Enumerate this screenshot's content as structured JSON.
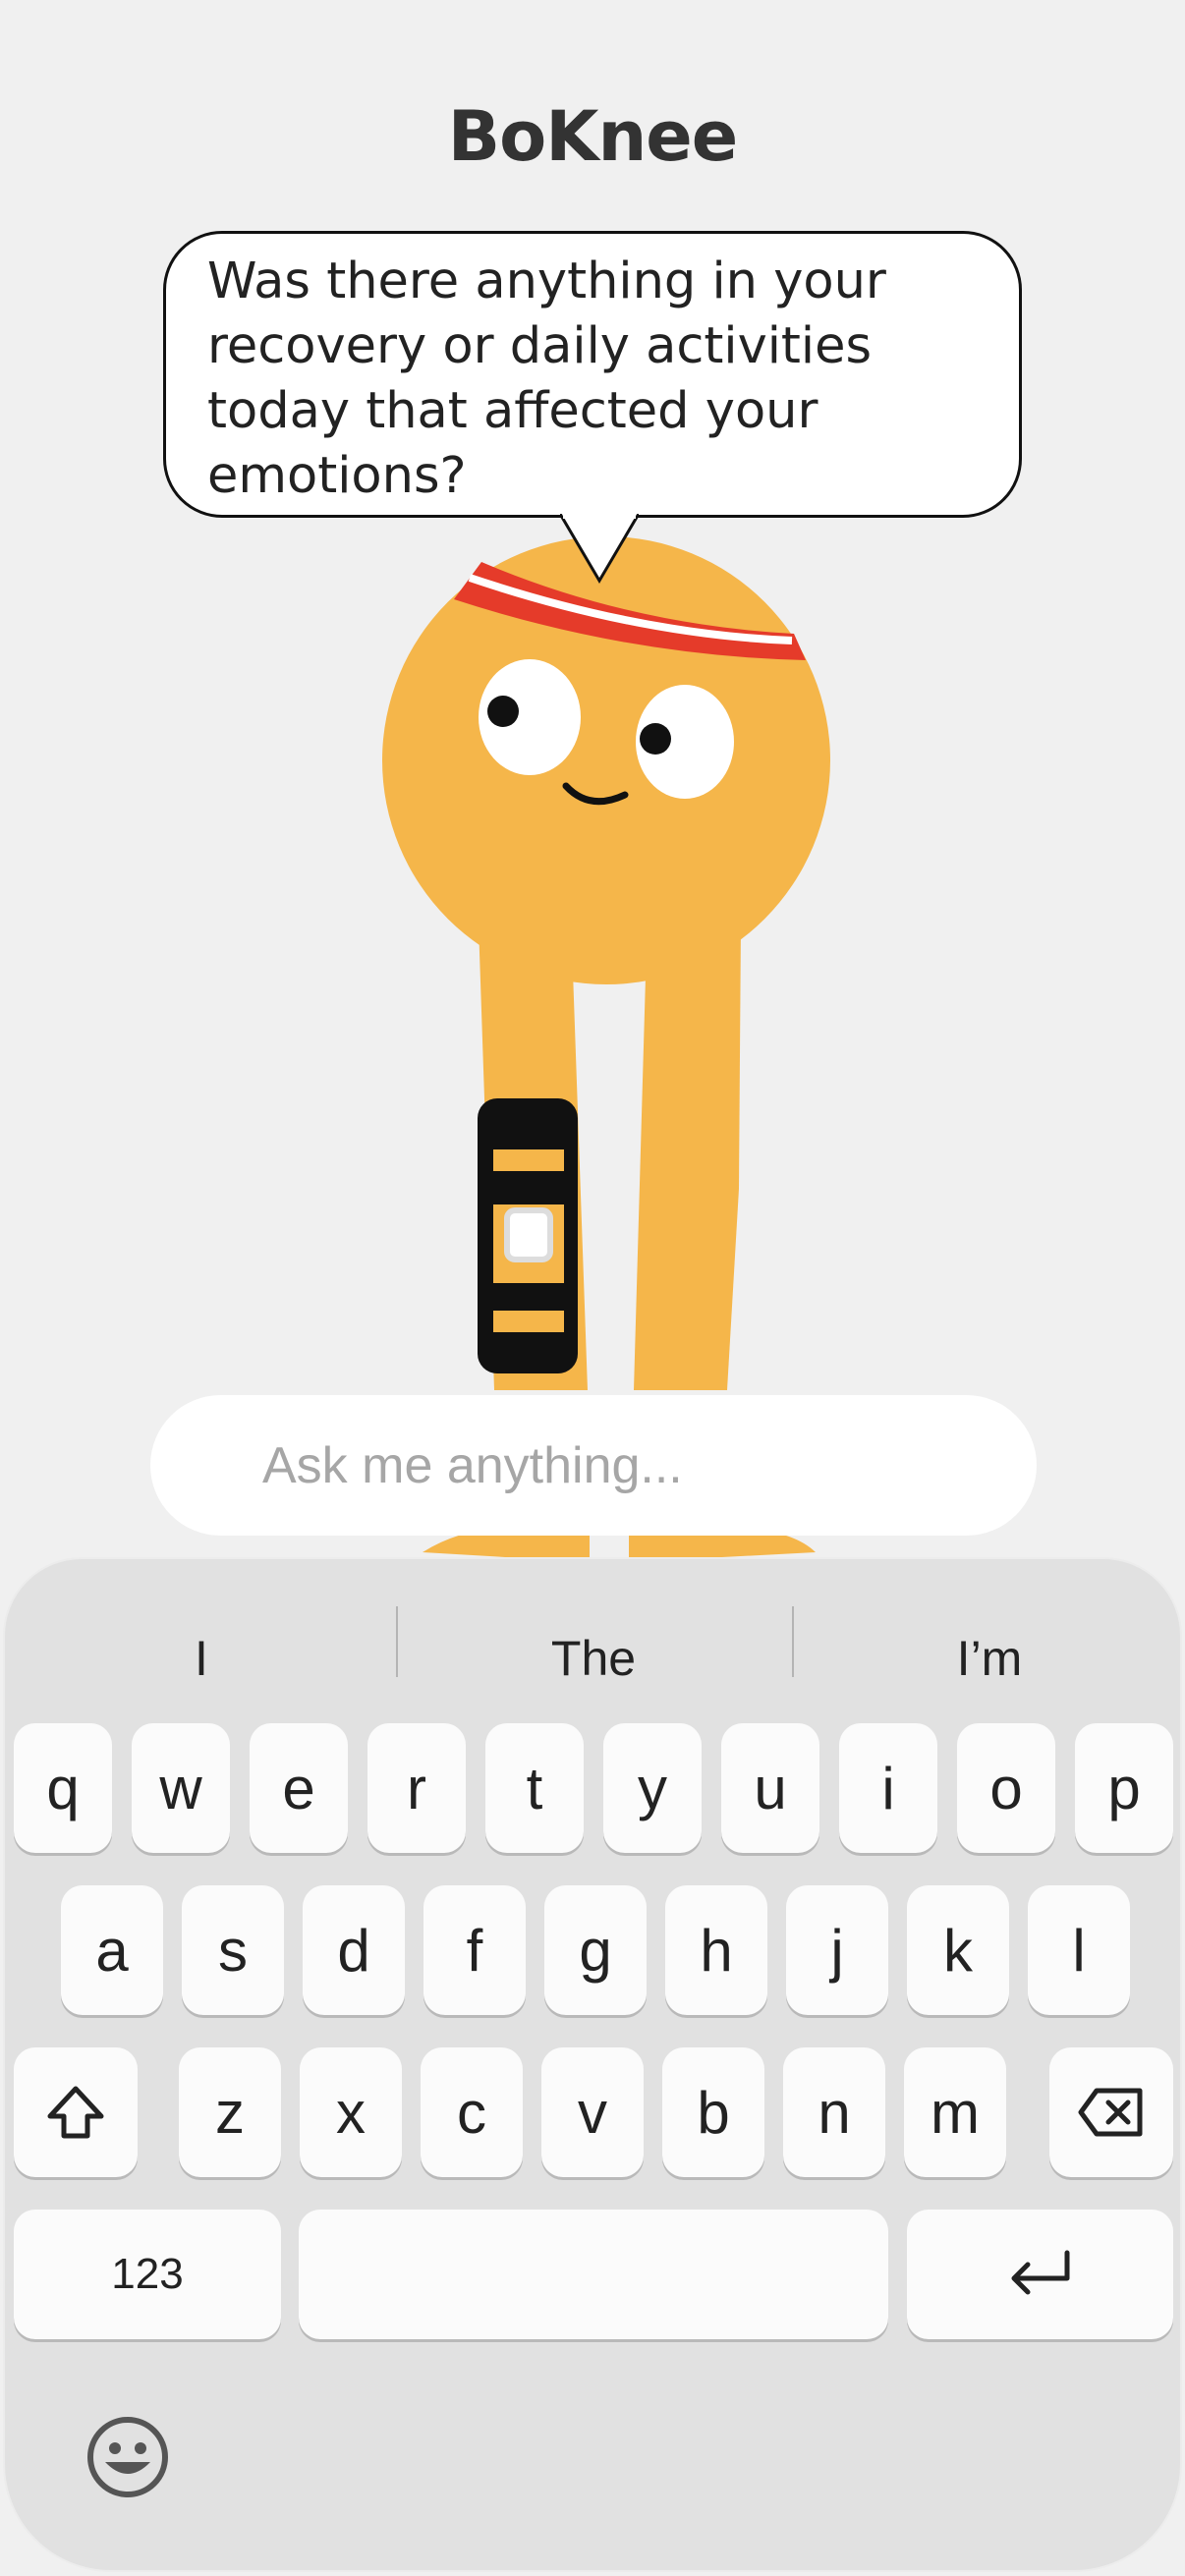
{
  "app": {
    "title": "BoKnee"
  },
  "assistant": {
    "message": "Was there anything in your recovery or daily activities today that affected your emotions?"
  },
  "chat_input": {
    "placeholder": "Ask me anything...",
    "value": ""
  },
  "keyboard": {
    "suggestions": [
      "I",
      "The",
      "I’m"
    ],
    "row1": [
      "q",
      "w",
      "e",
      "r",
      "t",
      "y",
      "u",
      "i",
      "o",
      "p"
    ],
    "row2": [
      "a",
      "s",
      "d",
      "f",
      "g",
      "h",
      "j",
      "k",
      "l"
    ],
    "row3": [
      "z",
      "x",
      "c",
      "v",
      "b",
      "n",
      "m"
    ],
    "numbers_label": "123",
    "icons": {
      "shift": "shift-icon",
      "delete": "backspace-icon",
      "return": "return-icon",
      "emoji": "emoji-icon"
    }
  },
  "colors": {
    "mascot": "#f5b64a",
    "headband": "#e53b2a",
    "background": "#f0f0f0"
  }
}
